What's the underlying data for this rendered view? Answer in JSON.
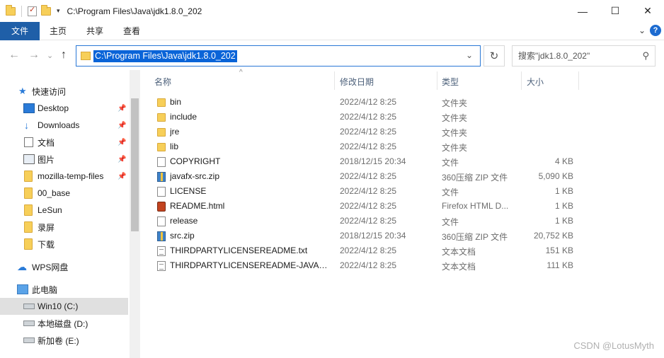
{
  "titlebar": {
    "path": "C:\\Program Files\\Java\\jdk1.8.0_202",
    "quick_access_dropdown": "▾",
    "minimize": "—",
    "maximize": "☐",
    "close": "✕"
  },
  "ribbon": {
    "tabs": [
      "文件",
      "主页",
      "共享",
      "查看"
    ],
    "collapse_glyph": "⌄",
    "help_glyph": "?"
  },
  "address": {
    "back_glyph": "←",
    "forward_glyph": "→",
    "recent_glyph": "⌄",
    "up_glyph": "↑",
    "path": "C:\\Program Files\\Java\\jdk1.8.0_202",
    "dropdown_glyph": "⌄",
    "refresh_glyph": "↻",
    "search_placeholder": "搜索\"jdk1.8.0_202\"",
    "search_glyph": "⚲"
  },
  "nav": {
    "items": [
      {
        "label": "快速访问",
        "icon": "star-icon"
      },
      {
        "label": "Desktop",
        "icon": "desktop-icon",
        "pinned": true
      },
      {
        "label": "Downloads",
        "icon": "download-icon",
        "pinned": true
      },
      {
        "label": "文档",
        "icon": "document-icon",
        "pinned": true
      },
      {
        "label": "图片",
        "icon": "picture-icon",
        "pinned": true
      },
      {
        "label": "mozilla-temp-files",
        "icon": "folder-icon",
        "pinned": true
      },
      {
        "label": "00_base",
        "icon": "folder-icon"
      },
      {
        "label": "LeSun",
        "icon": "folder-icon"
      },
      {
        "label": "录屏",
        "icon": "folder-icon"
      },
      {
        "label": "下载",
        "icon": "folder-icon"
      },
      {
        "label": "WPS网盘",
        "icon": "cloud-icon"
      },
      {
        "label": "此电脑",
        "icon": "computer-icon"
      },
      {
        "label": "Win10 (C:)",
        "icon": "drive-icon",
        "selected": true
      },
      {
        "label": "本地磁盘 (D:)",
        "icon": "drive-icon"
      },
      {
        "label": "新加卷 (E:)",
        "icon": "drive-icon"
      }
    ],
    "pin_glyph": "📌"
  },
  "filelist": {
    "columns": [
      "名称",
      "修改日期",
      "类型",
      "大小"
    ],
    "sort_glyph": "^",
    "rows": [
      {
        "name": "bin",
        "date": "2022/4/12 8:25",
        "type": "文件夹",
        "size": "",
        "icon": "folder"
      },
      {
        "name": "include",
        "date": "2022/4/12 8:25",
        "type": "文件夹",
        "size": "",
        "icon": "folder"
      },
      {
        "name": "jre",
        "date": "2022/4/12 8:25",
        "type": "文件夹",
        "size": "",
        "icon": "folder"
      },
      {
        "name": "lib",
        "date": "2022/4/12 8:25",
        "type": "文件夹",
        "size": "",
        "icon": "folder"
      },
      {
        "name": "COPYRIGHT",
        "date": "2018/12/15 20:34",
        "type": "文件",
        "size": "4 KB",
        "icon": "file"
      },
      {
        "name": "javafx-src.zip",
        "date": "2022/4/12 8:25",
        "type": "360压缩 ZIP 文件",
        "size": "5,090 KB",
        "icon": "zip"
      },
      {
        "name": "LICENSE",
        "date": "2022/4/12 8:25",
        "type": "文件",
        "size": "1 KB",
        "icon": "file"
      },
      {
        "name": "README.html",
        "date": "2022/4/12 8:25",
        "type": "Firefox HTML D...",
        "size": "1 KB",
        "icon": "html"
      },
      {
        "name": "release",
        "date": "2022/4/12 8:25",
        "type": "文件",
        "size": "1 KB",
        "icon": "file"
      },
      {
        "name": "src.zip",
        "date": "2018/12/15 20:34",
        "type": "360压缩 ZIP 文件",
        "size": "20,752 KB",
        "icon": "zip"
      },
      {
        "name": "THIRDPARTYLICENSEREADME.txt",
        "date": "2022/4/12 8:25",
        "type": "文本文档",
        "size": "151 KB",
        "icon": "txt"
      },
      {
        "name": "THIRDPARTYLICENSEREADME-JAVAF...",
        "date": "2022/4/12 8:25",
        "type": "文本文档",
        "size": "111 KB",
        "icon": "txt"
      }
    ]
  },
  "watermark": "CSDN @LotusMyth",
  "colors": {
    "file_tab": "#1f5fa8",
    "selection": "#0a64d8",
    "folder": "#f7cf59",
    "accent": "#2a7bd8"
  }
}
